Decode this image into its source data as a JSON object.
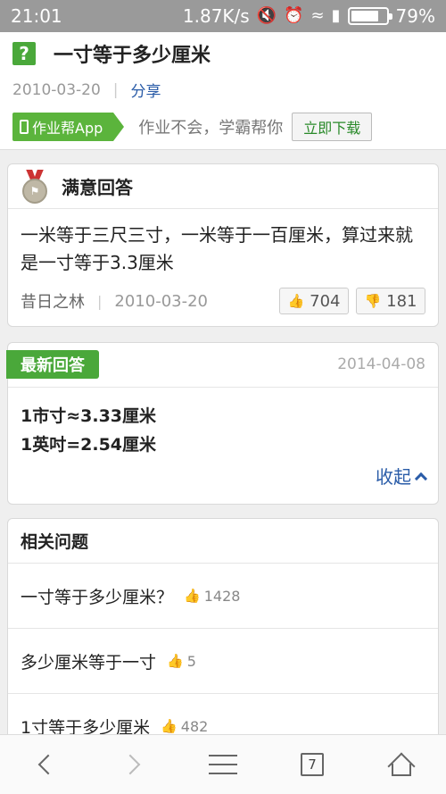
{
  "status_bar": {
    "time": "21:01",
    "speed": "1.87K/s",
    "battery": "79%",
    "battery_level": 0.79
  },
  "question": {
    "icon": "?",
    "title": "一寸等于多少厘米",
    "date": "2010-03-20",
    "share": "分享"
  },
  "promo": {
    "app_label": "作业帮App",
    "slogan": "作业不会，学霸帮你",
    "download": "立即下载"
  },
  "best_answer": {
    "header": "满意回答",
    "text": "一米等于三尺三寸，一米等于一百厘米，算过来就是一寸等于3.3厘米",
    "author": "昔日之林",
    "date": "2010-03-20",
    "likes": "704",
    "dislikes": "181"
  },
  "latest_answer": {
    "header": "最新回答",
    "date": "2014-04-08",
    "lines": [
      "1市寸≈3.33厘米",
      "1英吋=2.54厘米"
    ],
    "collapse": "收起"
  },
  "related": {
    "header": "相关问题",
    "items": [
      {
        "title": "一寸等于多少厘米？",
        "count": "1428"
      },
      {
        "title": "多少厘米等于一寸",
        "count": "5"
      },
      {
        "title": "1寸等于多少厘米",
        "count": "482"
      }
    ]
  },
  "bottom_nav": {
    "tabs_count": "7"
  },
  "colors": {
    "accent_green": "#4aa83a",
    "link_blue": "#2a5ca8",
    "status_bar": "#9a9a9a"
  },
  "icons": [
    "wifi-icon",
    "signal-icon",
    "battery-icon",
    "medal-icon",
    "thumb-up-icon",
    "thumb-down-icon",
    "back-icon",
    "forward-icon",
    "menu-icon",
    "tabs-icon",
    "home-icon"
  ]
}
